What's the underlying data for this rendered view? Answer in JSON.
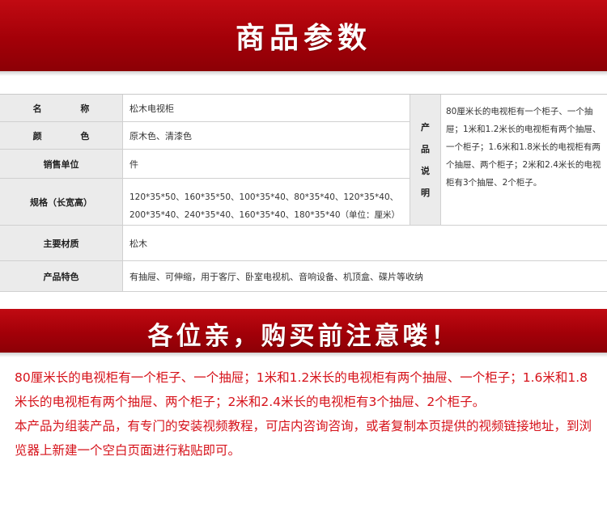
{
  "header": {
    "title": "商品参数"
  },
  "specs": {
    "name_label": "名  称",
    "name_value": "松木电视柜",
    "color_label": "颜  色",
    "color_value": "原木色、清漆色",
    "unit_label": "销售单位",
    "unit_value": "件",
    "size_label": "规格（长宽高）",
    "size_value_line1": "120*35*50、160*35*50、100*35*40、80*35*40、120*35*40、",
    "size_value_line2": "200*35*40、240*35*40、160*35*40、180*35*40（单位：厘米）",
    "material_label": "主要材质",
    "material_value": "松木",
    "feature_label": "产品特色",
    "feature_value": "有抽屉、可伸缩，用于客厅、卧室电视机、音响设备、机顶盒、碟片等收纳",
    "desc_label_chars": [
      "产",
      "品",
      "说",
      "明"
    ],
    "desc_value": "80厘米长的电视柜有一个柜子、一个抽屉；1米和1.2米长的电视柜有两个抽屉、一个柜子；1.6米和1.8米长的电视柜有两个抽屉、两个柜子；2米和2.4米长的电视柜有3个抽屉、2个柜子。"
  },
  "notice_banner": {
    "title": "各位亲，购买前注意喽！"
  },
  "notice": {
    "paragraph1": "80厘米长的电视柜有一个柜子、一个抽屉；1米和1.2米长的电视柜有两个抽屉、一个柜子；1.6米和1.8米长的电视柜有两个抽屉、两个柜子；2米和2.4米长的电视柜有3个抽屉、2个柜子。",
    "paragraph2": "本产品为组装产品，有专门的安装视频教程，可店内咨询咨询，或者复制本页提供的视频链接地址，到浏览器上新建一个空白页面进行粘贴即可。"
  },
  "colors": {
    "banner_red": "#a30008",
    "notice_red": "#d6121a",
    "label_gray": "#ebebeb"
  }
}
